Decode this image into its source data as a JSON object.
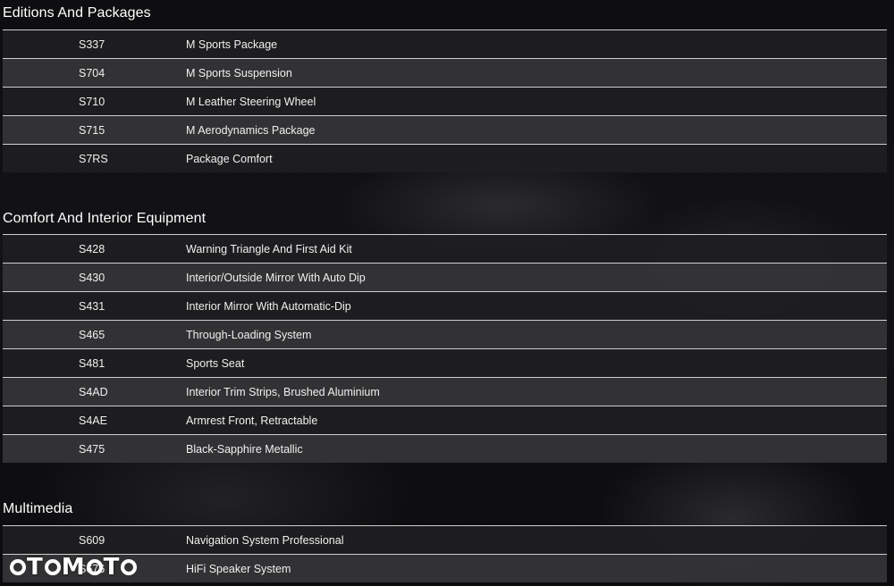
{
  "sections": [
    {
      "title": "Editions And Packages",
      "rows": [
        {
          "code": "S337",
          "desc": "M Sports Package"
        },
        {
          "code": "S704",
          "desc": "M Sports Suspension"
        },
        {
          "code": "S710",
          "desc": "M Leather Steering Wheel"
        },
        {
          "code": "S715",
          "desc": "M Aerodynamics Package"
        },
        {
          "code": "S7RS",
          "desc": "Package Comfort"
        }
      ]
    },
    {
      "title": "Comfort And Interior Equipment",
      "rows": [
        {
          "code": "S428",
          "desc": "Warning Triangle And First Aid Kit"
        },
        {
          "code": "S430",
          "desc": "Interior/Outside Mirror With Auto Dip"
        },
        {
          "code": "S431",
          "desc": "Interior Mirror With Automatic-Dip"
        },
        {
          "code": "S465",
          "desc": "Through-Loading System"
        },
        {
          "code": "S481",
          "desc": "Sports Seat"
        },
        {
          "code": "S4AD",
          "desc": "Interior Trim Strips, Brushed Aluminium"
        },
        {
          "code": "S4AE",
          "desc": "Armrest Front, Retractable"
        },
        {
          "code": "S475",
          "desc": "Black-Sapphire Metallic"
        }
      ]
    },
    {
      "title": "Multimedia",
      "rows": [
        {
          "code": "S609",
          "desc": "Navigation System Professional"
        },
        {
          "code": "S676",
          "desc": "HiFi Speaker System"
        }
      ]
    }
  ],
  "watermark": {
    "text": "OTOMOTO"
  }
}
